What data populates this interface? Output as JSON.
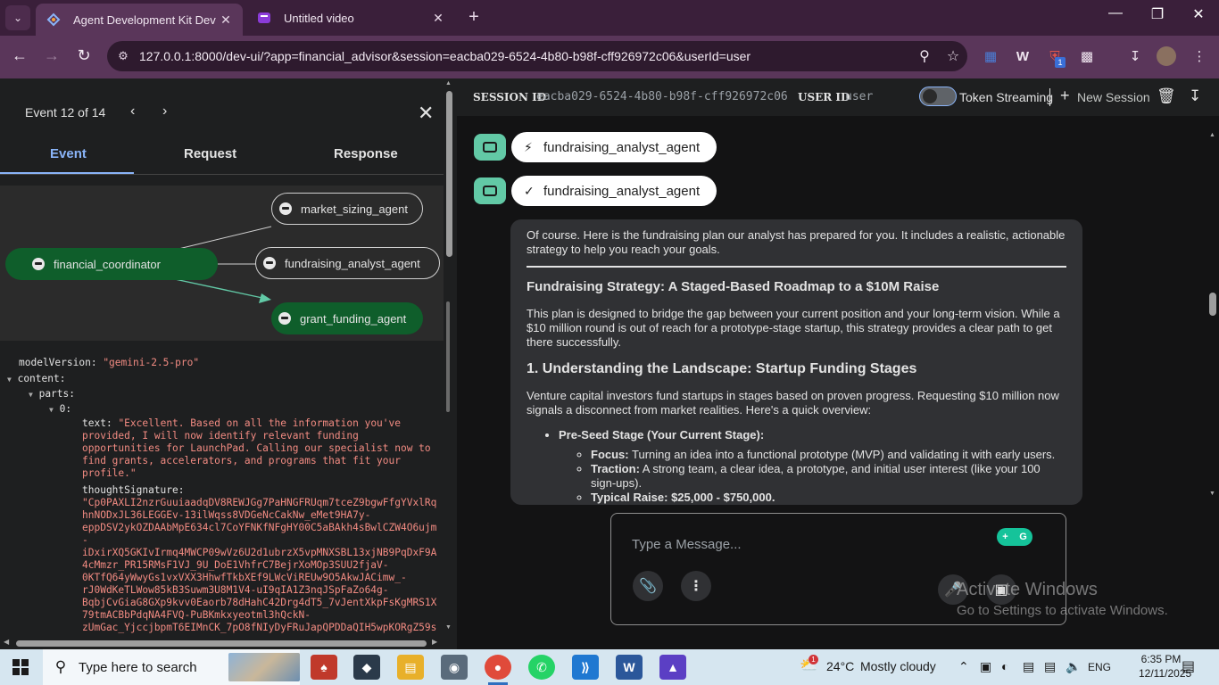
{
  "browser": {
    "tabs": [
      {
        "title": "Agent Development Kit Dev UI",
        "active": true
      },
      {
        "title": "Untitled video",
        "active": false
      }
    ],
    "url": "127.0.0.1:8000/dev-ui/?app=financial_advisor&session=eacba029-6524-4b80-b98f-cff926972c06&userId=user",
    "extension_badge": "1"
  },
  "left_panel": {
    "event_counter": "Event 12 of 14",
    "tabs": [
      "Event",
      "Request",
      "Response"
    ],
    "selected_tab": "Event",
    "graph": {
      "nodes": [
        {
          "id": "financial_coordinator",
          "label": "financial_coordinator",
          "style": "filled"
        },
        {
          "id": "market_sizing_agent",
          "label": "market_sizing_agent",
          "style": "outline"
        },
        {
          "id": "fundraising_analyst_agent",
          "label": "fundraising_analyst_agent",
          "style": "outline"
        },
        {
          "id": "grant_funding_agent",
          "label": "grant_funding_agent",
          "style": "filled"
        }
      ]
    },
    "event_json": {
      "model_version_key": "modelVersion:",
      "model_version_value": "\"gemini-2.5-pro\"",
      "content_key": "content:",
      "parts_key": "parts:",
      "index_key": "0:",
      "text_key": "text:",
      "text_lines": [
        "\"Excellent. Based on all the information you've",
        "provided, I will now identify relevant funding",
        "opportunities for LaunchPad. Calling our specialist now to",
        "find grants, accelerators, and programs that fit your",
        "profile.\""
      ],
      "thought_key": "thoughtSignature:",
      "thought_lines": [
        "\"Cp0PAXLI2nzrGuuiaadqDV8REWJGg7PaHNGFRUqm7tceZ9bgwFfgYVxlRq",
        "hnNODxJL36LEGGEv-13ilWqss8VDGeNcCakNw_eMet9HA7y-",
        "eppDSV2ykOZDAAbMpE634cl7CoYFNKfNFgHY00C5aBAkh4sBwlCZW4O6ujm",
        "-",
        "iDxirXQ5GKIvIrmq4MWCP09wVz6U2d1ubrzX5vpMNXSBL13xjNB9PqDxF9A",
        "4cMmzr_PR15RMsF1VJ_9U_DoE1VhfrC7BejrXoMOp3SUU2fjaV-",
        "0KTfQ64yWwyGs1vxVXX3HhwfTkbXEf9LWcViREUw9O5AkwJACimw_-",
        "rJ0WdKeTLWow85kB3Suwm3U8M1V4-uI9qIA1Z3nqJSpFaZo64g-",
        "BqbjCvGiaG8GXp9kvv0Eaorb78dHahC42Drg4dT5_7vJentXkpFsKgMRS1X",
        "79tmACBbPdqNA4FVQ-PuBKmkxyeotml3hQckN-",
        "zUmGac_YjccjbpmT6EIMnCK_7pO8fNIyDyFRuJapQPDDaQIH5wpKORgZ59s"
      ]
    }
  },
  "right_panel": {
    "session_label": "SESSION ID",
    "session_value": "eacba029-6524-4b80-b98f-cff926972c06",
    "user_label": "USER ID",
    "user_value": "user",
    "token_streaming": "Token Streaming",
    "new_session": "New Session",
    "function_call_label": "fundraising_analyst_agent",
    "function_response_label": "fundraising_analyst_agent",
    "message": {
      "intro": "Of course. Here is the fundraising plan our analyst has prepared for you. It includes a realistic, actionable strategy to help you reach your goals.",
      "heading": "Fundraising Strategy: A Staged-Based Roadmap to a $10M Raise",
      "para1": "This plan is designed to bridge the gap between your current position and your long-term vision. While a $10 million round is out of reach for a prototype-stage startup, this strategy provides a clear path to get there successfully.",
      "section1": "1. Understanding the Landscape: Startup Funding Stages",
      "para2": "Venture capital investors fund startups in stages based on proven progress. Requesting $10 million now signals a disconnect from market realities. Here's a quick overview:",
      "bullet1": "Pre-Seed Stage (Your Current Stage):",
      "sub1_label": "Focus:",
      "sub1_text": " Turning an idea into a functional prototype (MVP) and validating it with early users.",
      "sub2_label": "Traction:",
      "sub2_text": " A strong team, a clear idea, a prototype, and initial user interest (like your 100 sign-ups).",
      "sub3_label": "Typical Raise: $25,000 - $750,000."
    },
    "input_placeholder": "Type a Message...",
    "watermark_title": "Activate Windows",
    "watermark_sub": "Go to Settings to activate Windows."
  },
  "taskbar": {
    "search_placeholder": "Type here to search",
    "weather_temp": "24°C",
    "weather_desc": "Mostly cloudy",
    "weather_badge": "1",
    "language": "ENG",
    "time": "6:35 PM",
    "date": "12/11/2025"
  },
  "colors": {
    "accent_blue": "#8ab4f8",
    "node_green": "#0f5e2b",
    "avatar_teal": "#62c9a6",
    "json_string": "#f28b82"
  }
}
